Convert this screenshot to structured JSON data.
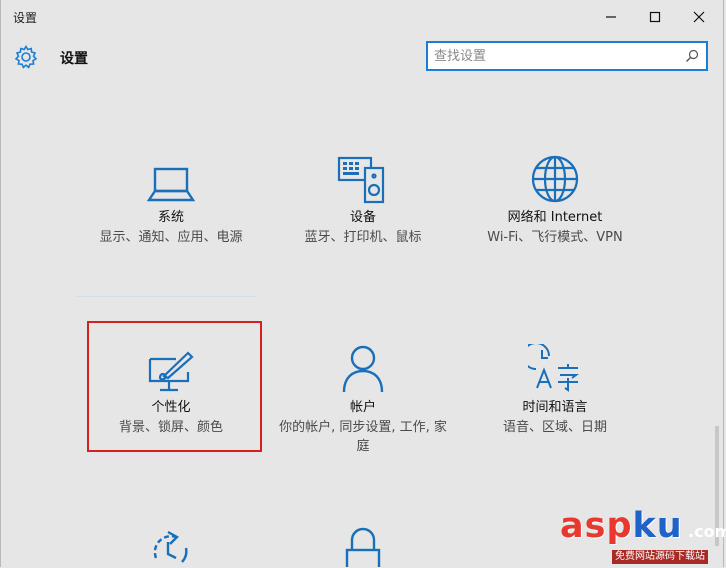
{
  "window": {
    "title": "设置",
    "controls": [
      "minimize",
      "maximize",
      "close"
    ]
  },
  "header": {
    "icon": "gear-icon",
    "title": "设置",
    "search_placeholder": "查找设置",
    "search_icon": "search-icon"
  },
  "colors": {
    "accent": "#1a7fd4",
    "highlight_border": "#d6201e",
    "background": "#e6e6e6"
  },
  "categories": [
    {
      "name": "系统",
      "desc": "显示、通知、应用、电源",
      "icon": "laptop-icon"
    },
    {
      "name": "设备",
      "desc": "蓝牙、打印机、鼠标",
      "icon": "devices-icon"
    },
    {
      "name": "网络和 Internet",
      "desc": "Wi-Fi、飞行模式、VPN",
      "icon": "globe-icon"
    },
    {
      "name": "个性化",
      "desc": "背景、锁屏、颜色",
      "icon": "personalization-icon"
    },
    {
      "name": "帐户",
      "desc": "你的帐户, 同步设置, 工作, 家庭",
      "icon": "person-icon"
    },
    {
      "name": "时间和语言",
      "desc": "语音、区域、日期",
      "icon": "time-language-icon"
    },
    {
      "name": "",
      "desc": "",
      "icon": "update-security-icon"
    },
    {
      "name": "",
      "desc": "",
      "icon": "privacy-lock-icon"
    }
  ],
  "selected_category": "个性化",
  "watermark": {
    "text_a": "asp",
    "text_b": "ku",
    "text_c": ".com",
    "subtitle": "免费网站源码下载站"
  }
}
